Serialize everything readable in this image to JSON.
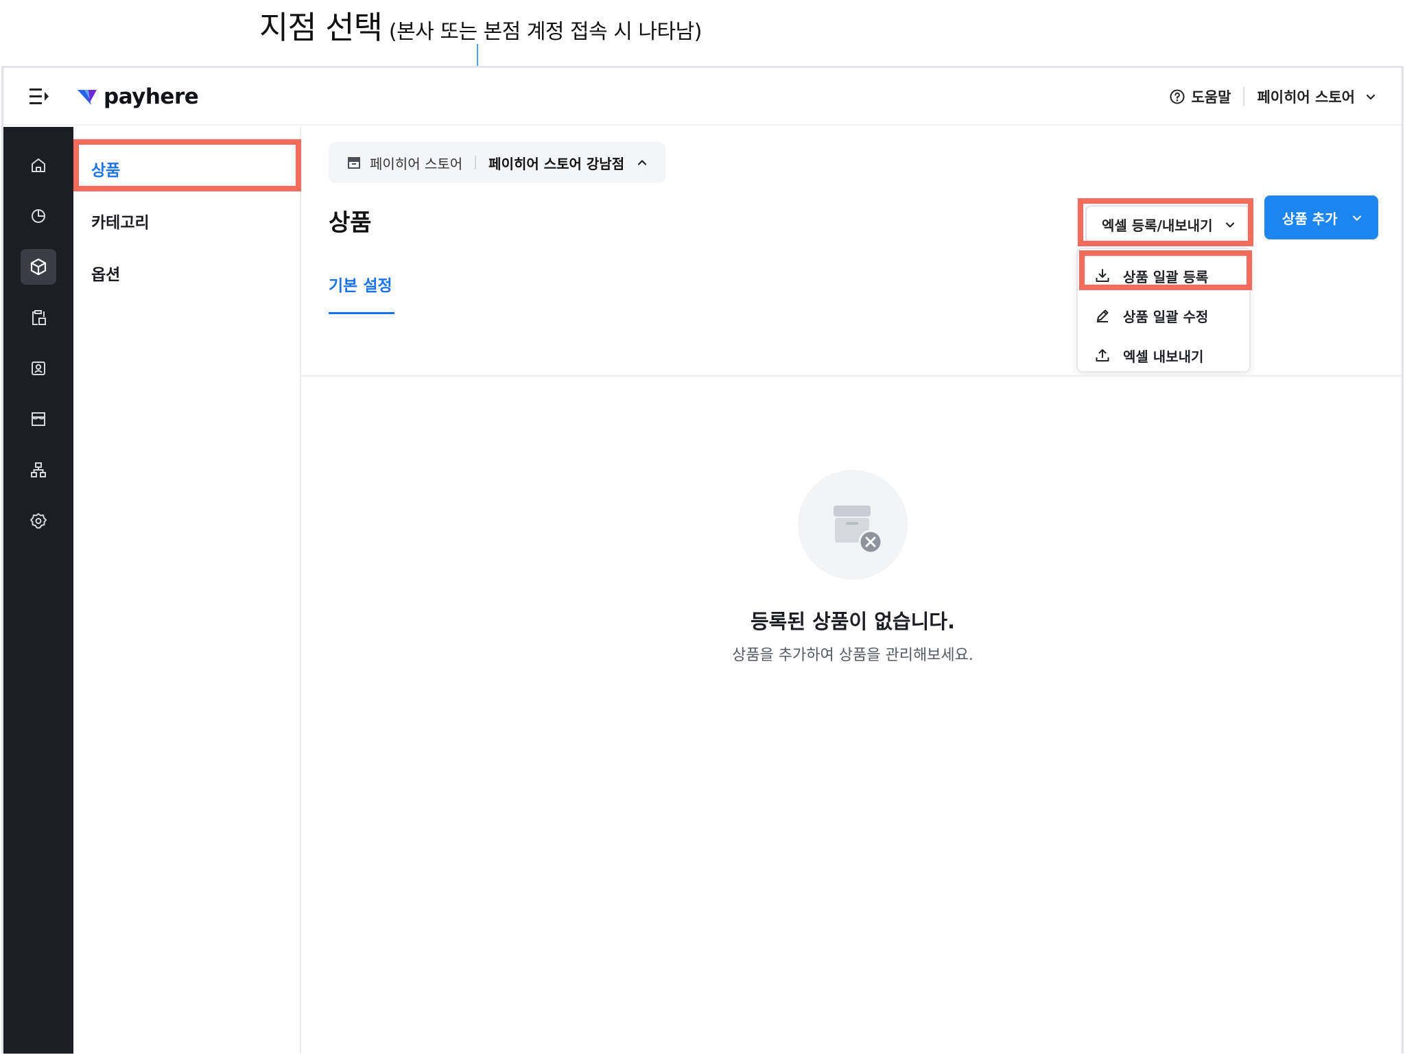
{
  "annotation": {
    "title": "지점 선택",
    "subtitle": "(본사 또는 본점 계정 접속 시 나타남)"
  },
  "header": {
    "logo_text": "payhere",
    "help_label": "도움말",
    "store_name": "페이히어 스토어"
  },
  "rail": {
    "items": [
      "home-icon",
      "chart-icon",
      "box-icon",
      "clipboard-icon",
      "contact-icon",
      "store-icon",
      "org-chart-icon",
      "gear-icon"
    ],
    "active_index": 2
  },
  "submenu": {
    "items": [
      {
        "label": "상품",
        "active": true
      },
      {
        "label": "카테고리",
        "active": false
      },
      {
        "label": "옵션",
        "active": false
      }
    ]
  },
  "branch_selector": {
    "parent": "페이히어 스토어",
    "child": "페이히어 스토어 강남점"
  },
  "page": {
    "title": "상품",
    "excel_button": "엑셀 등록/내보내기",
    "add_button": "상품 추가",
    "tab_label": "기본 설정"
  },
  "excel_menu": {
    "items": [
      {
        "label": "상품 일괄 등록",
        "icon": "download-icon"
      },
      {
        "label": "상품 일괄 수정",
        "icon": "pencil-icon"
      },
      {
        "label": "엑셀 내보내기",
        "icon": "upload-icon"
      }
    ]
  },
  "empty_state": {
    "title": "등록된 상품이 없습니다.",
    "description": "상품을 추가하여 상품을 관리해보세요."
  },
  "colors": {
    "accent": "#1a73e8",
    "primary_button": "#1c86ee",
    "highlight": "#f26b5b",
    "rail_bg": "#1c1e23"
  }
}
